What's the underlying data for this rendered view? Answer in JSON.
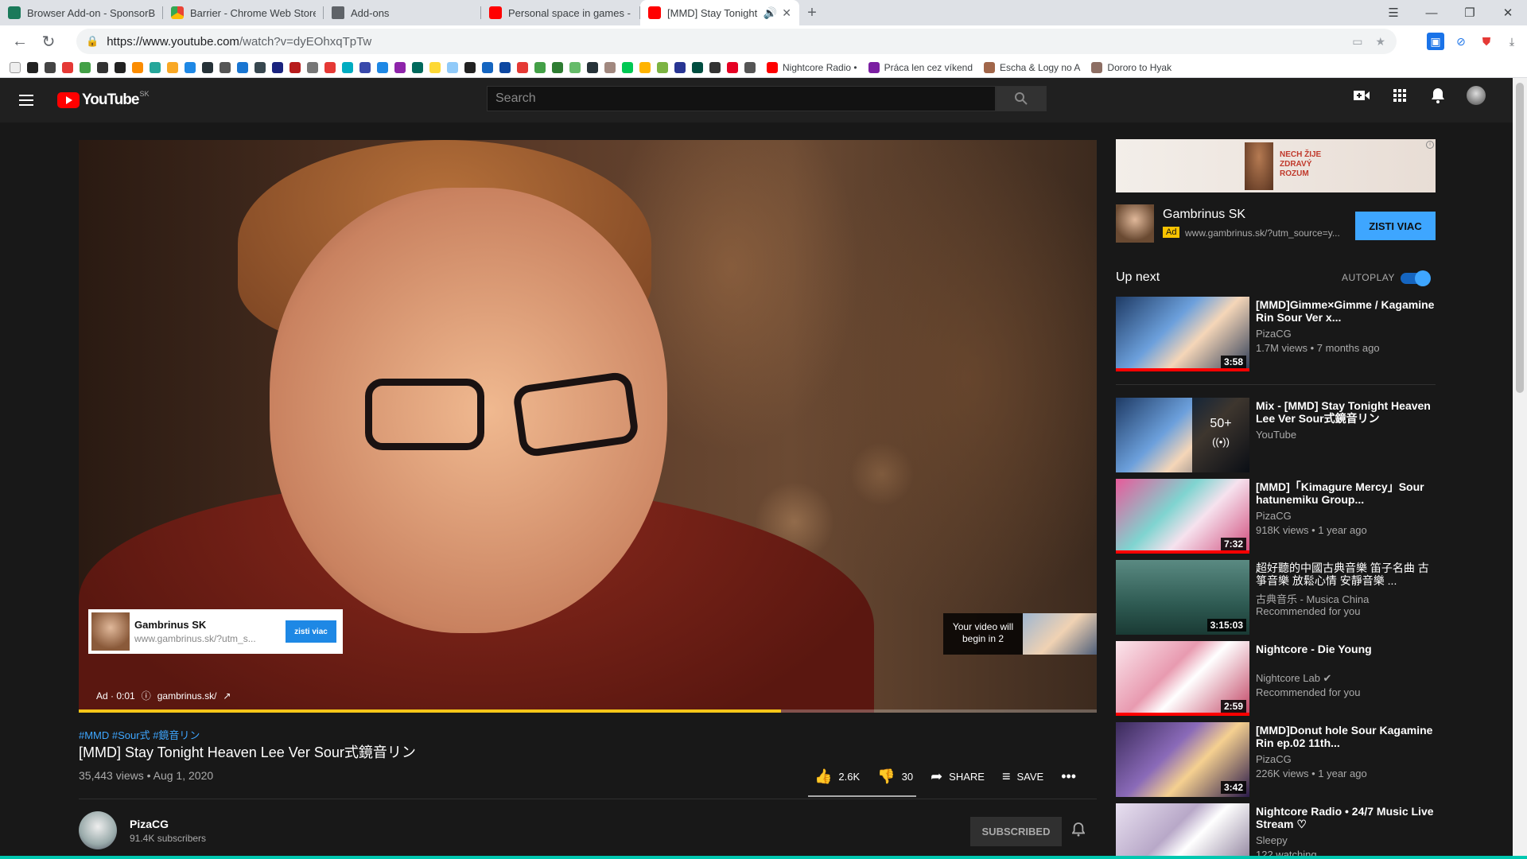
{
  "browser": {
    "tabs": [
      {
        "label": "Browser Add-on - SponsorBlock",
        "color": "#1a7a5a"
      },
      {
        "label": "Barrier - Chrome Web Store",
        "color": "#4285f4"
      },
      {
        "label": "Add-ons",
        "color": "#5f6368"
      },
      {
        "label": "Personal space in games - YouTube",
        "color": "#ff0000"
      },
      {
        "label": "[MMD] Stay Tonight Heaven Lee",
        "color": "#ff0000"
      }
    ],
    "active_tab_index": 4,
    "new_tab_glyph": "+",
    "url_host": "https://www.youtube.com",
    "url_path": "/watch?v=dyEOhxqTpTw",
    "bookmarks": [
      "Nightcore Radio •",
      "Práca len cez víkend",
      "Escha & Logy no A",
      "Dororo to Hyak"
    ]
  },
  "youtube": {
    "logo_text": "YouTube",
    "logo_region": "SK",
    "search_placeholder": "Search"
  },
  "player": {
    "ad_card_title": "Gambrinus SK",
    "ad_card_url": "www.gambrinus.sk/?utm_s...",
    "ad_card_button": "zisti viac",
    "ad_label": "Ad · 0:01",
    "ad_domain": "gambrinus.sk/",
    "countdown_line1": "Your video will",
    "countdown_line2": "begin in 2",
    "progress_fraction": 0.69
  },
  "video": {
    "hashtags": "#MMD #Sour式 #鏡音リン",
    "title": "[MMD] Stay Tonight Heaven Lee Ver Sour式鏡音リン",
    "meta": "35,443 views • Aug 1, 2020",
    "likes": "2.6K",
    "dislikes": "30",
    "share_label": "SHARE",
    "save_label": "SAVE"
  },
  "channel": {
    "name": "PizaCG",
    "subscribers": "91.4K subscribers",
    "subscribe_label": "SUBSCRIBED"
  },
  "sidebar": {
    "ad_banner_text": "NECH ŽIJE ZDRAVÝ ROZUM",
    "ad_name": "Gambrinus SK",
    "ad_badge": "Ad",
    "ad_url": "www.gambrinus.sk/?utm_source=y...",
    "ad_cta": "ZISTI VIAC",
    "upnext_label": "Up next",
    "autoplay_label": "AUTOPLAY",
    "autoplay_on": true,
    "mix_count": "50+",
    "items": [
      {
        "title": "[MMD]Gimme×Gimme / Kagamine Rin Sour Ver x...",
        "channel": "PizaCG",
        "meta": "1.7M views • 7 months ago",
        "duration": "3:58"
      },
      {
        "title": "Mix - [MMD] Stay Tonight Heaven Lee Ver Sour式鏡音リン",
        "channel": "YouTube",
        "meta": "",
        "duration": ""
      },
      {
        "title": "[MMD]「Kimagure Mercy」Sour hatunemiku Group...",
        "channel": "PizaCG",
        "meta": "918K views • 1 year ago",
        "duration": "7:32"
      },
      {
        "title": "超好聽的中國古典音樂 笛子名曲 古箏音樂 放鬆心情 安靜音樂 ...",
        "channel": "古典音乐 - Musica China",
        "meta": "Recommended for you",
        "duration": "3:15:03"
      },
      {
        "title": "Nightcore - Die Young",
        "channel": "Nightcore Lab ✔",
        "meta": "Recommended for you",
        "duration": "2:59"
      },
      {
        "title": "[MMD]Donut hole Sour Kagamine Rin ep.02 11th...",
        "channel": "PizaCG",
        "meta": "226K views • 1 year ago",
        "duration": "3:42"
      },
      {
        "title": "Nightcore Radio • 24/7 Music Live Stream ♡",
        "channel": "Sleepy",
        "meta": "122 watching",
        "duration": ""
      }
    ]
  }
}
